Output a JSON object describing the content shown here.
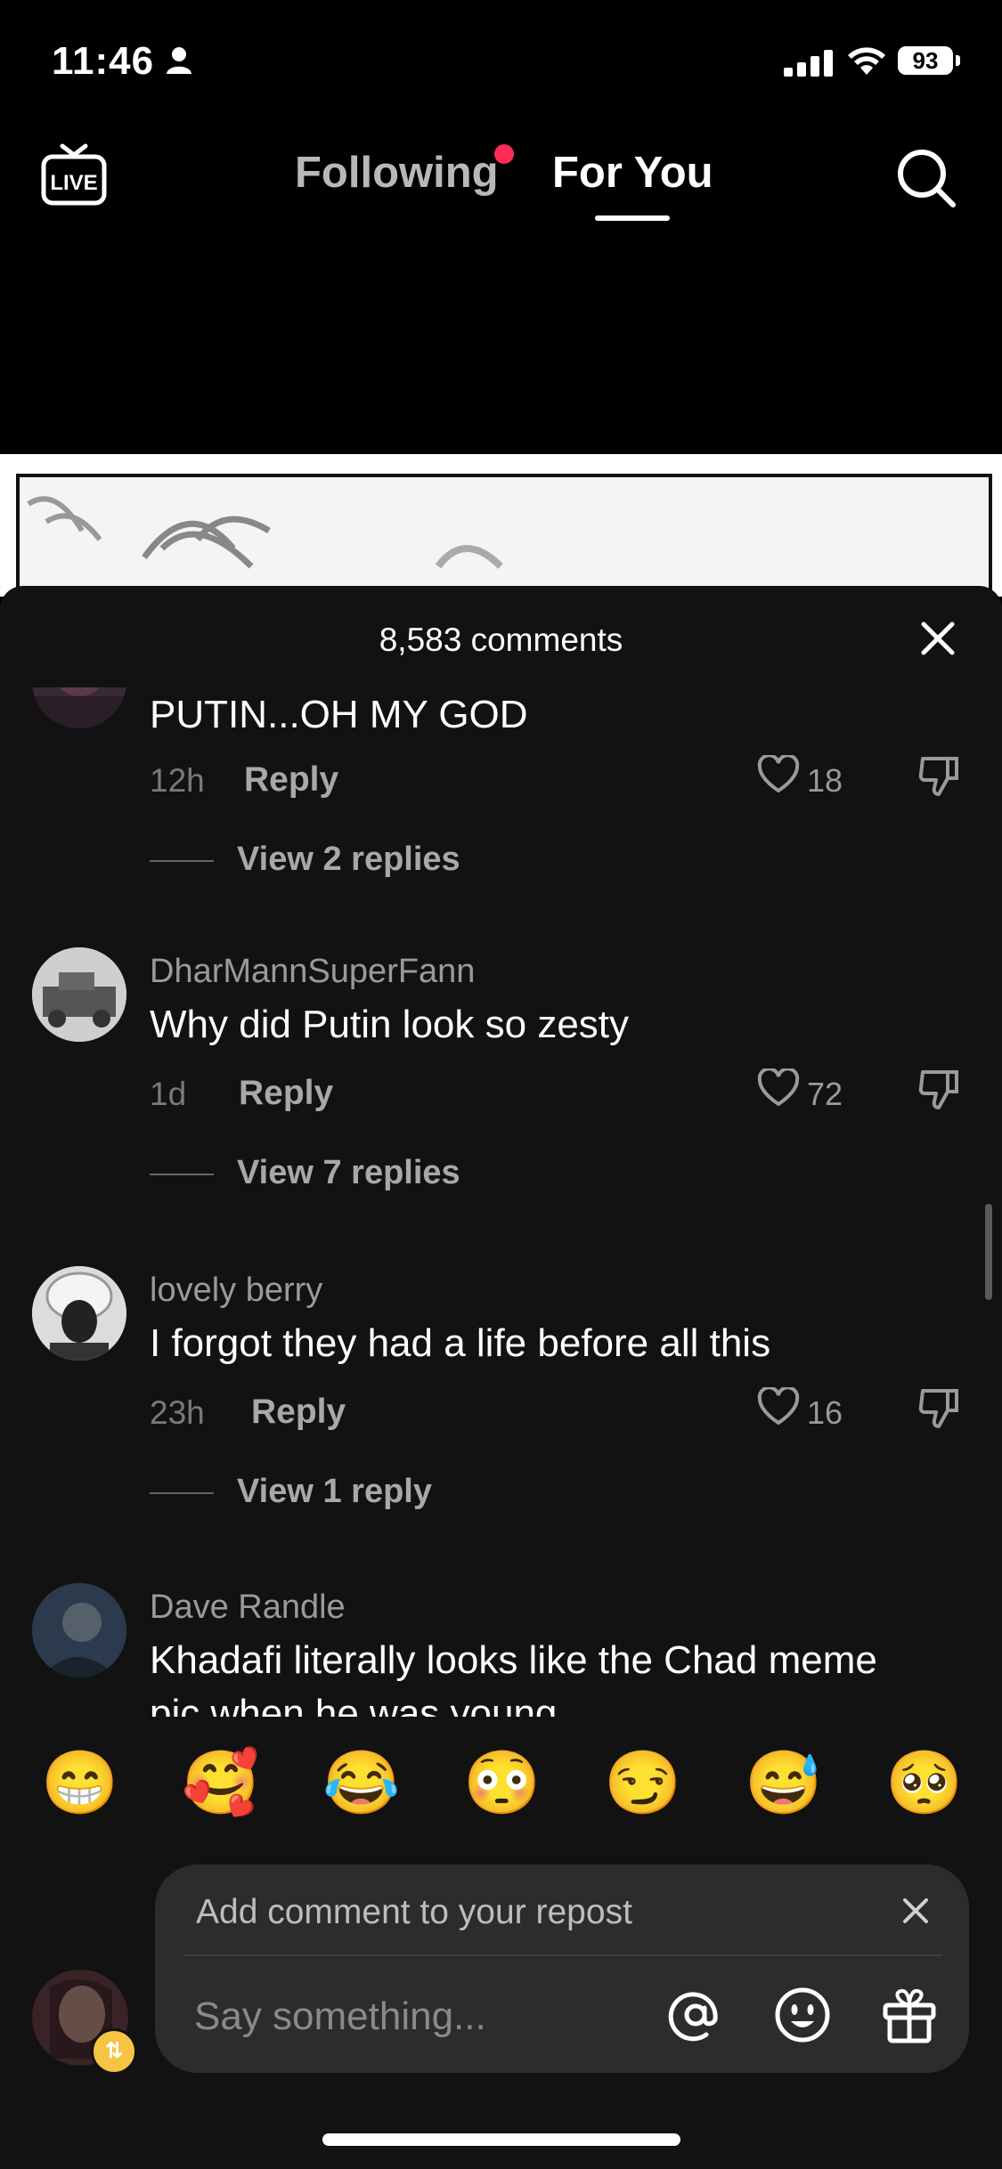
{
  "status_bar": {
    "time": "11:46",
    "battery": "93"
  },
  "nav": {
    "live_label": "LIVE",
    "tabs": [
      {
        "label": "Following",
        "has_notification": true
      },
      {
        "label": "For You",
        "active": true
      }
    ]
  },
  "comments_panel": {
    "count_label": "8,583 comments",
    "comments": [
      {
        "username": "",
        "text": "PUTIN...OH MY GOD",
        "age": "12h",
        "reply_label": "Reply",
        "likes": "18",
        "view_replies": "View 2 replies"
      },
      {
        "username": "DharMannSuperFann",
        "text": "Why did Putin look so zesty",
        "age": "1d",
        "reply_label": "Reply",
        "likes": "72",
        "view_replies": "View 7 replies"
      },
      {
        "username": "lovely berry",
        "text": "I forgot they had a life before all this",
        "age": "23h",
        "reply_label": "Reply",
        "likes": "16",
        "view_replies": "View 1 reply"
      },
      {
        "username": "Dave Randle",
        "text": "Khadafi literally looks like the Chad meme",
        "text2": "pic when he was young"
      }
    ]
  },
  "emoji_bar": [
    "😁",
    "🥰",
    "😂",
    "😳",
    "😏",
    "😅",
    "🥺"
  ],
  "composer": {
    "repost_label": "Add comment to your repost",
    "placeholder": "Say something..."
  },
  "colors": {
    "accent": "#fe2c55",
    "sheet_bg": "#121212",
    "input_bg": "#2c2c2c",
    "repost_badge": "#f6c343"
  }
}
